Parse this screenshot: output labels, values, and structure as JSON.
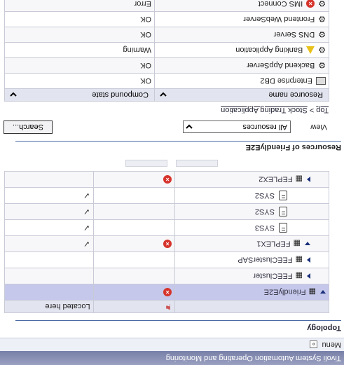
{
  "app": {
    "title": "Tivoli System Automation Operating and Monitoring"
  },
  "menu": {
    "label": "Menu",
    "toggle": "»"
  },
  "topology": {
    "title": "Topology",
    "columns": [
      "",
      "",
      "Located here"
    ],
    "rows": [
      {
        "name": "FriendlyE2E",
        "state": "error",
        "expand": "expanded",
        "depth": 0,
        "selected": true,
        "located": ""
      },
      {
        "name": "FEECluster",
        "state": "",
        "expand": "collapsed",
        "depth": 1,
        "located": ""
      },
      {
        "name": "FEEClusterSAP",
        "state": "",
        "expand": "collapsed",
        "depth": 1,
        "located": ""
      },
      {
        "name": "FEPLEX1",
        "state": "error",
        "expand": "expanded",
        "depth": 1,
        "located": "✓"
      },
      {
        "name": "SYS3",
        "state": "",
        "expand": "none",
        "depth": 2,
        "located": "✓"
      },
      {
        "name": "SYS2",
        "state": "",
        "expand": "none",
        "depth": 2,
        "located": "✓"
      },
      {
        "name": "SYS2",
        "state": "",
        "expand": "none",
        "depth": 2,
        "located": "✓"
      },
      {
        "name": "FEPLEX2",
        "state": "error",
        "expand": "collapsed",
        "depth": 1,
        "located": ""
      }
    ]
  },
  "resources": {
    "title": "Resources of FriendlyE2E",
    "view_label": "View",
    "view_value": "All resources",
    "search_label": "Search...",
    "breadcrumb": [
      "Top",
      ">",
      "Stock Trading Application"
    ],
    "columns": [
      "Resource name",
      "Compound state"
    ],
    "rows": [
      {
        "name": "Enterprise DB2",
        "icon": "database-icon",
        "state": "OK"
      },
      {
        "name": "Backend AppServer",
        "icon": "gear-icon",
        "state": "OK"
      },
      {
        "name": "Banking Application",
        "icon": "warning-gear-icon",
        "state": "Warning"
      },
      {
        "name": "DNS Server",
        "icon": "gear-icon",
        "state": "OK"
      },
      {
        "name": "Frontend WebServer",
        "icon": "gear-icon",
        "state": "OK"
      },
      {
        "name": "IMS Connect",
        "icon": "error-gear-icon",
        "state": "Error"
      }
    ]
  },
  "colors": {
    "selected_row": "#c5c8ea",
    "error": "#d6342c",
    "warning": "#e8c21a",
    "accent": "#4a6aa5"
  }
}
